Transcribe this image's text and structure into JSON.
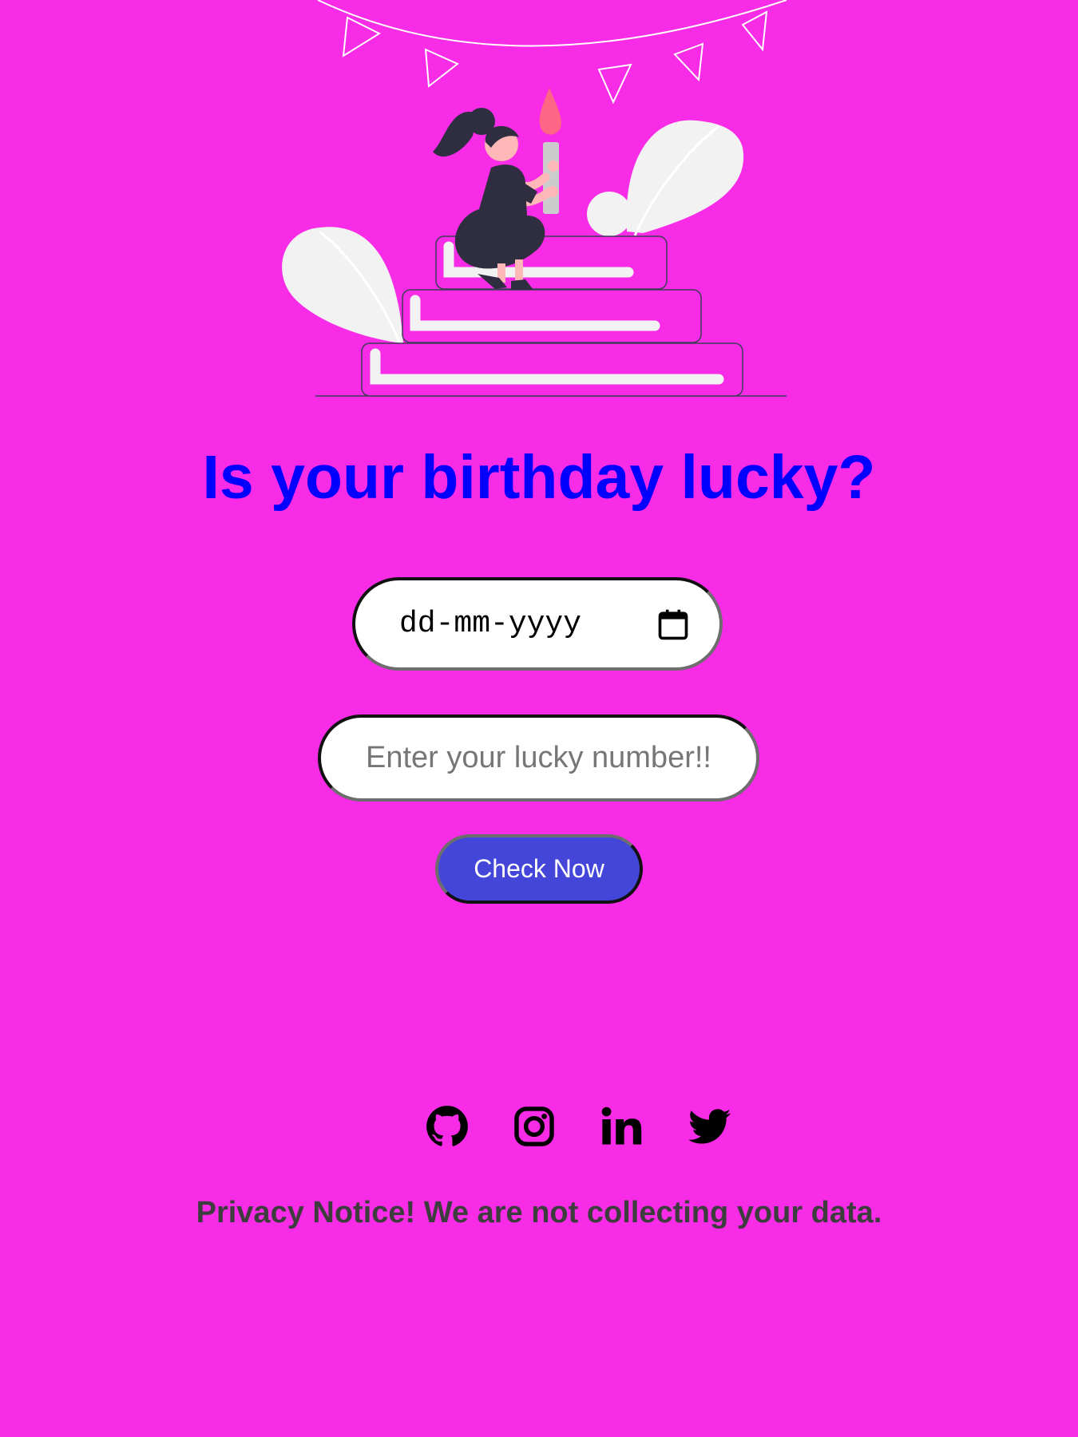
{
  "page": {
    "background_color": "#f82ce6"
  },
  "illustration": {
    "name": "birthday-cake-girl-illustration"
  },
  "header": {
    "title": "Is your birthday lucky?",
    "title_color": "#0000ff"
  },
  "form": {
    "date_input": {
      "placeholder": "dd-mm-yyyy",
      "icon": "calendar-icon"
    },
    "lucky_number_input": {
      "placeholder": "Enter your lucky number!!",
      "value": ""
    },
    "check_button": {
      "label": "Check Now",
      "color": "#4346d9"
    }
  },
  "footer": {
    "social_links": [
      {
        "name": "github",
        "icon": "github-icon"
      },
      {
        "name": "instagram",
        "icon": "instagram-icon"
      },
      {
        "name": "linkedin",
        "icon": "linkedin-icon"
      },
      {
        "name": "twitter",
        "icon": "twitter-icon"
      }
    ],
    "privacy_notice": "Privacy Notice! We are not collecting your data."
  }
}
